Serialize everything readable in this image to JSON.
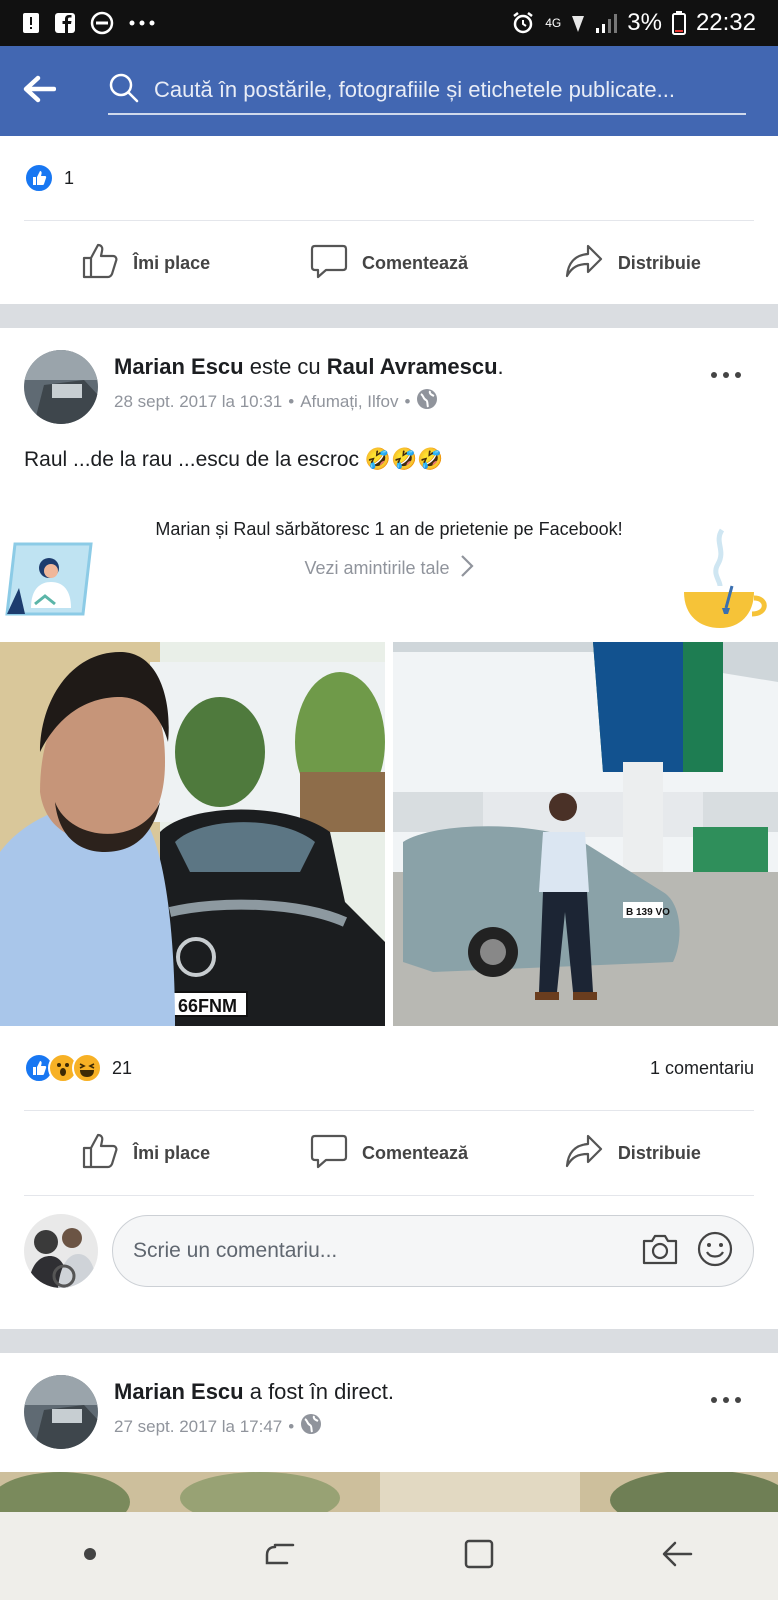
{
  "status_bar": {
    "battery": "3%",
    "time": "22:32",
    "network": "4G"
  },
  "search": {
    "placeholder": "Caută în postările, fotografiile și etichetele publicate..."
  },
  "top_post": {
    "reaction_count": "1",
    "actions": {
      "like": "Îmi place",
      "comment": "Comentează",
      "share": "Distribuie"
    }
  },
  "post1": {
    "author": "Marian Escu",
    "connector": " este cu ",
    "tagged": "Raul Avramescu",
    "suffix": ".",
    "date": "28 sept. 2017 la 10:31",
    "location": "Afumați, Ilfov",
    "text": "Raul ...de la rau ...escu  de la escroc 🤣🤣🤣",
    "memory_title": "Marian și Raul sărbătoresc 1 an de prietenie pe Facebook!",
    "memory_link": "Vezi amintirile tale",
    "photo_plate_left": "66FNM",
    "photo_plate_right": "B 139 VO",
    "reaction_count": "21",
    "comments": "1 comentariu",
    "actions": {
      "like": "Îmi place",
      "comment": "Comentează",
      "share": "Distribuie"
    },
    "comment_placeholder": "Scrie un comentariu..."
  },
  "post2": {
    "author": "Marian Escu",
    "connector": " a fost în direct.",
    "date": "27 sept. 2017 la 17:47"
  },
  "colors": {
    "brand": "#4267b2",
    "like": "#1877f2",
    "haha": "#f7b125"
  }
}
